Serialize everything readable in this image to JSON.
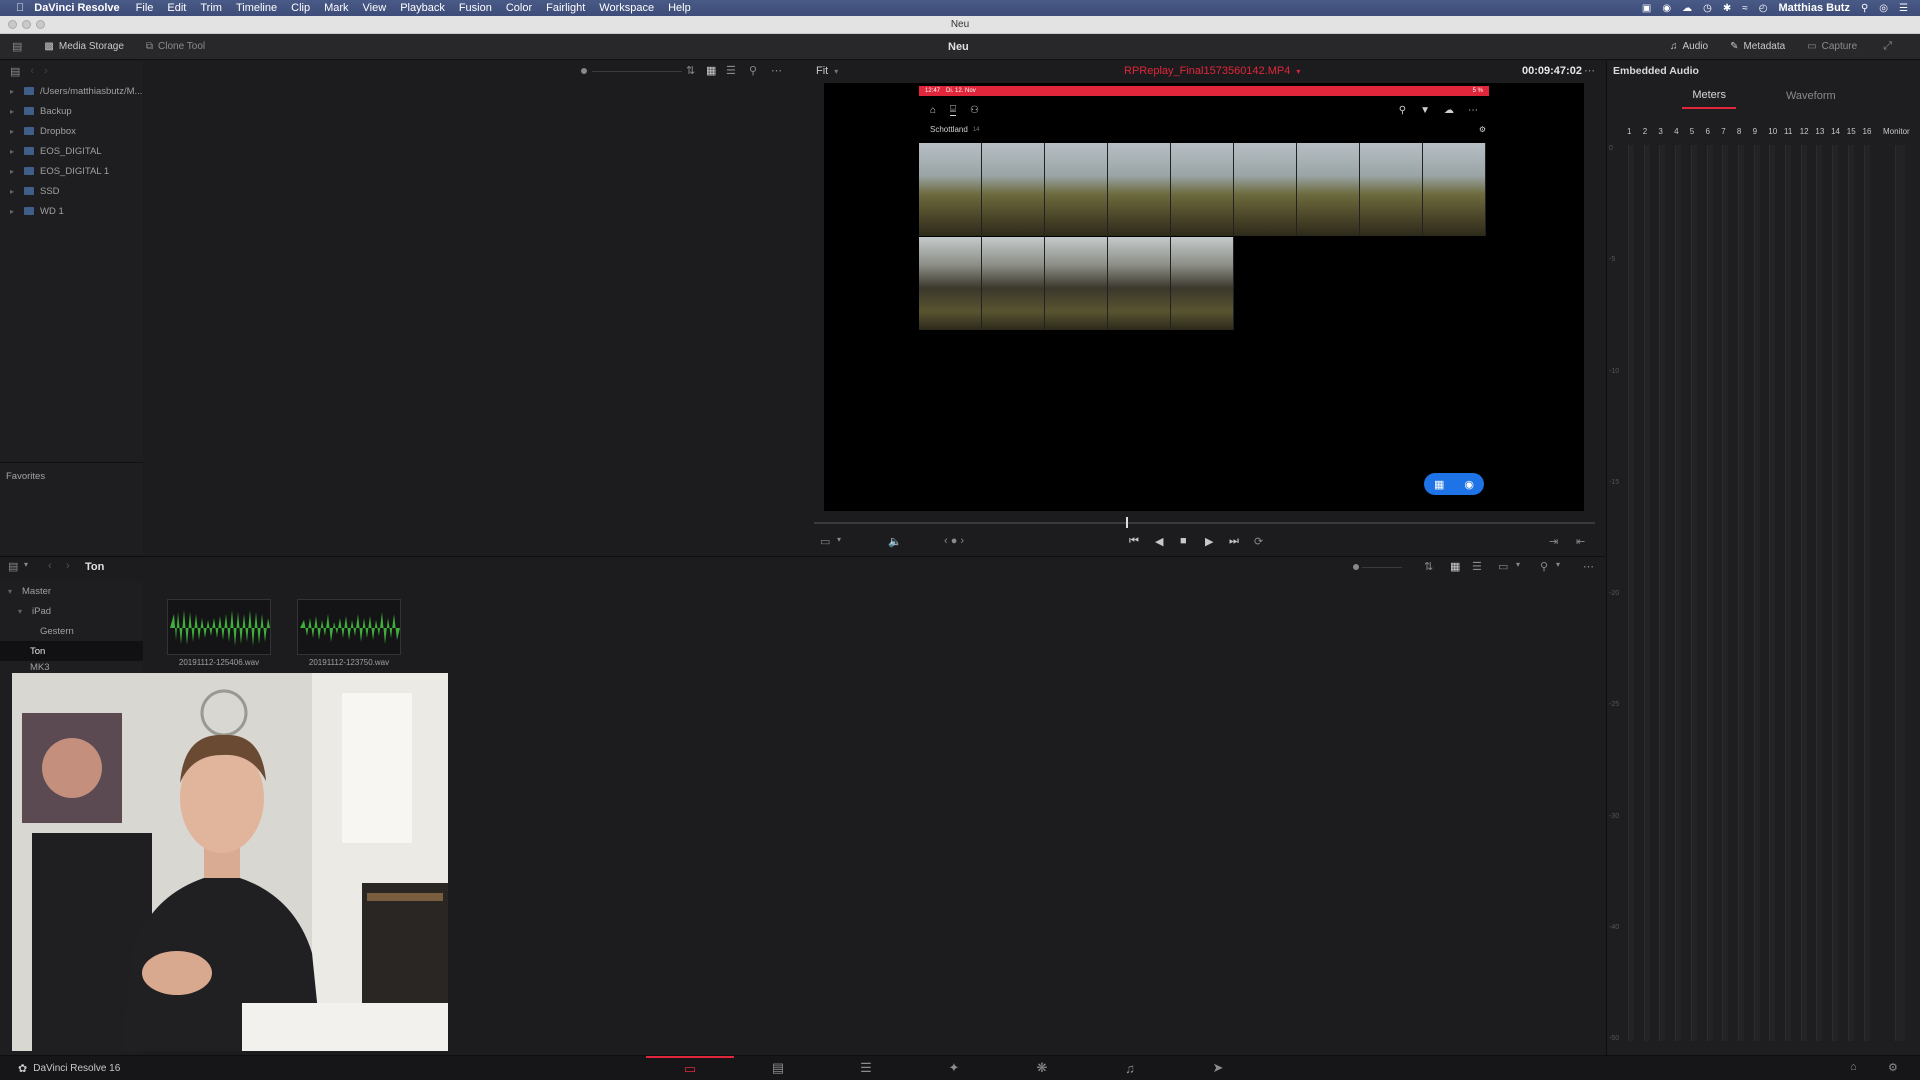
{
  "menubar": {
    "app": "DaVinci Resolve",
    "items": [
      "File",
      "Edit",
      "Trim",
      "Timeline",
      "Clip",
      "Mark",
      "View",
      "Playback",
      "Fusion",
      "Color",
      "Fairlight",
      "Workspace",
      "Help"
    ],
    "user": "Matthias Butz"
  },
  "window": {
    "title": "Neu"
  },
  "toolbar": {
    "media_storage": "Media Storage",
    "clone_tool": "Clone Tool",
    "project": "Neu",
    "audio": "Audio",
    "metadata": "Metadata",
    "capture": "Capture"
  },
  "media_storage": {
    "locations": [
      {
        "label": "/Users/matthiasbutz/M..."
      },
      {
        "label": "Backup"
      },
      {
        "label": "Dropbox"
      },
      {
        "label": "EOS_DIGITAL"
      },
      {
        "label": "EOS_DIGITAL 1"
      },
      {
        "label": "SSD"
      },
      {
        "label": "WD 1"
      }
    ],
    "favorites": "Favorites"
  },
  "viewer": {
    "zoom": "Fit",
    "clip_name": "RPReplay_Final1573560142.MP4",
    "timecode": "00:09:47:02",
    "phone_status_time": "12:47",
    "phone_status_date": "Di. 12. Nov",
    "phone_battery": "5 %",
    "album": "Schottland",
    "album_count": "14",
    "scrub_progress": 0.4
  },
  "audio_panel": {
    "title": "Embedded Audio",
    "tab_meters": "Meters",
    "tab_waveform": "Waveform",
    "channels": [
      "1",
      "2",
      "3",
      "4",
      "5",
      "6",
      "7",
      "8",
      "9",
      "10",
      "11",
      "12",
      "13",
      "14",
      "15",
      "16"
    ],
    "monitor": "Monitor",
    "scale": [
      "0",
      "-5",
      "-10",
      "-15",
      "-20",
      "-25",
      "-30",
      "-40",
      "-50"
    ]
  },
  "media_pool": {
    "current_bin": "Ton",
    "bins": [
      {
        "label": "Master"
      },
      {
        "label": "iPad"
      },
      {
        "label": "Gestern"
      },
      {
        "label": "Ton"
      },
      {
        "label": "MK3"
      }
    ],
    "clips": [
      {
        "name": "20191112-125406.wav"
      },
      {
        "name": "20191112-123750.wav"
      }
    ]
  },
  "footer": {
    "app_version": "DaVinci Resolve 16"
  },
  "colors": {
    "accent_red": "#e0263a",
    "waveform_green": "#3fae3a",
    "camera_blue": "#1e74e6"
  }
}
